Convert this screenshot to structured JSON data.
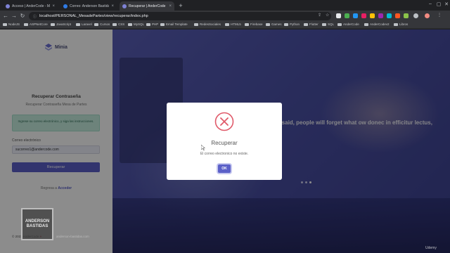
{
  "browser": {
    "tabs": [
      {
        "title": "Acceso | AnderCode - Mesa de",
        "active": false
      },
      {
        "title": "Correo: Anderson Bastidas - O",
        "active": false
      },
      {
        "title": "Recuperar | AnderCode - Mesa",
        "active": true
      }
    ],
    "new_tab": "+",
    "url": "localhost/PERSONAL_MesadePartes/view/recuperar/index.php",
    "bookmarks": [
      "NodeJS",
      "ASPNetCore",
      "JavaScript",
      "Laravel",
      "Cursos",
      "CSS",
      "MySQL",
      "PHP",
      "Email Template",
      "RedesSociales",
      "HTML5",
      "Firebase",
      "Games",
      "Python",
      "Flutter",
      "SQL",
      "AnderCode",
      "AnderCodev2",
      "Libros"
    ]
  },
  "page": {
    "logo": "Minia",
    "title": "Recuperar Contraseña",
    "subtitle": "Recuperar Contraseña Mesa de Partes",
    "alert": "Ingrese su correo electrónico, y siga las instrucciones.",
    "email_label": "Correo electrónico",
    "email_value": "sucorreo1@andercode.com",
    "submit_label": "Recuperar",
    "back_prefix": "Regresa a ",
    "back_link": "Acceder",
    "copyright_prefix": "© 2023 AnderCode ",
    "copyright_heart": "♥",
    "hero_text": "hat you said, people will forget what ow donec in efficitur lectus, nec"
  },
  "modal": {
    "title": "Recuperar",
    "message": "El correo electronico no existe.",
    "ok_label": "OK"
  },
  "watermark": {
    "name": "ANDERSON BASTIDAS",
    "url": "anderson-bastidas.com"
  },
  "udemy": "Udemy",
  "colors": {
    "accent": "#5b60c8",
    "error": "#e05a6a",
    "alert_bg": "#c7eee0"
  }
}
